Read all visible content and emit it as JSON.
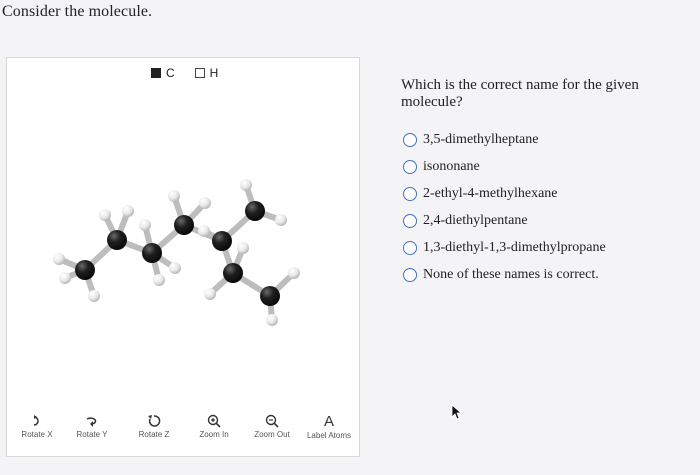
{
  "prompt": "Consider the molecule.",
  "viewer": {
    "legend": [
      {
        "symbol": "C",
        "style": "filled"
      },
      {
        "symbol": "H",
        "style": "empty"
      }
    ],
    "toolbar": [
      {
        "label": "Rotate X",
        "icon": "rotate-x-icon"
      },
      {
        "label": "Rotate Y",
        "icon": "rotate-y-icon"
      },
      {
        "label": "Rotate Z",
        "icon": "rotate-z-icon"
      },
      {
        "label": "Zoom In",
        "icon": "zoom-in-icon"
      },
      {
        "label": "Zoom Out",
        "icon": "zoom-out-icon"
      },
      {
        "label": "Label Atoms",
        "icon": "label-atoms-icon",
        "glyph": "A"
      }
    ],
    "colors": {
      "carbon": "#1f1f1f",
      "hydrogen": "#e9e9e9",
      "bond": "#bdbdbd"
    }
  },
  "question": "Which is the correct name for the given molecule?",
  "options": [
    "3,5-dimethylheptane",
    "isononane",
    "2-ethyl-4-methylhexane",
    "2,4-diethylpentane",
    "1,3-diethyl-1,3-dimethylpropane",
    "None of these names is correct."
  ],
  "accent_color": "#3f70c8"
}
